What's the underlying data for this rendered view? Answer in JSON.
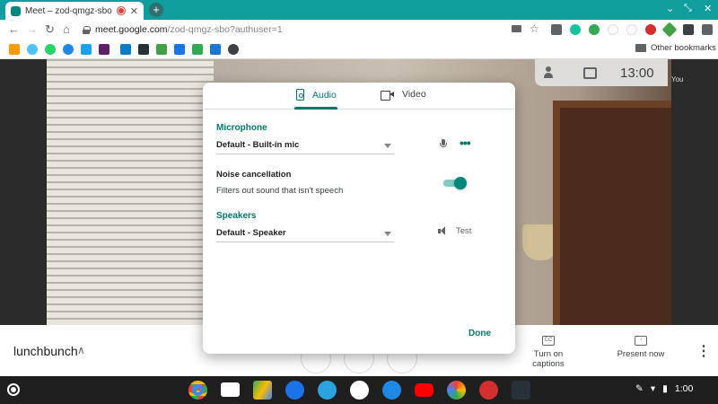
{
  "browser": {
    "tab_title": "Meet – zod-qmgz-sbo",
    "tab_close": "✕",
    "new_tab": "+",
    "url_host": "meet.google.com",
    "url_path": "/zod-qmgz-sbo?authuser=1",
    "other_bookmarks": "Other bookmarks",
    "win_minimize": "⌄",
    "win_restore": "⤡",
    "win_close": "✕",
    "nav_back": "←",
    "nav_forward": "→",
    "nav_reload": "↻",
    "nav_home": "⌂",
    "star": "☆"
  },
  "meet": {
    "clock": "13:00",
    "self_tile_label": "You",
    "meeting_name": "lunchbunch",
    "chevron": "∧",
    "captions_label": "Turn on captions",
    "captions_glyph": "CC",
    "present_label": "Present now",
    "present_glyph": "↑",
    "more": "⋮"
  },
  "dialog": {
    "tabs": [
      {
        "label": "Audio",
        "active": true
      },
      {
        "label": "Video",
        "active": false
      }
    ],
    "microphone": {
      "label": "Microphone",
      "selected": "Default - Built-in mic"
    },
    "more_glyph": "•••",
    "noise_cancellation": {
      "title": "Noise cancellation",
      "description": "Filters out sound that isn't speech",
      "enabled": true
    },
    "speakers": {
      "label": "Speakers",
      "selected": "Default - Speaker",
      "test_label": "Test"
    },
    "done_label": "Done"
  },
  "shelf": {
    "status_time": "1:00",
    "pen_glyph": "✎",
    "wifi_glyph": "▾",
    "battery_glyph": "▮"
  },
  "colors": {
    "accent": "#00796b",
    "tabstrip": "#0f9d9d",
    "shelf": "#1f1f1f"
  }
}
